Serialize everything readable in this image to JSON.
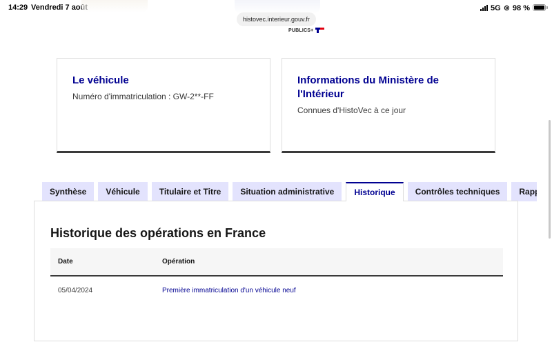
{
  "status_bar": {
    "time": "14:29",
    "date": "Vendredi 7 août",
    "network": "5G",
    "battery": "98 %"
  },
  "browser": {
    "url": "histovec.interieur.gouv.fr",
    "brand": "PUBLICS+"
  },
  "cards": [
    {
      "title": "Le véhicule",
      "desc": "Numéro d'immatriculation : GW-2**-FF"
    },
    {
      "title": "Informations du Ministère de l'Intérieur",
      "desc": "Connues d'HistoVec à ce jour"
    }
  ],
  "tabs": [
    {
      "label": "Synthèse"
    },
    {
      "label": "Véhicule"
    },
    {
      "label": "Titulaire et Titre"
    },
    {
      "label": "Situation administrative"
    },
    {
      "label": "Historique"
    },
    {
      "label": "Contrôles techniques"
    },
    {
      "label": "Rapport"
    }
  ],
  "active_tab": "Historique",
  "panel": {
    "title": "Historique des opérations en France",
    "columns": [
      "Date",
      "Opération"
    ],
    "rows": [
      {
        "date": "05/04/2024",
        "operation": "Première immatriculation d'un véhicule neuf"
      }
    ]
  },
  "colors": {
    "accent": "#000091",
    "tab_bg": "#e3e3fd",
    "border_dark": "#3a3a3a"
  }
}
